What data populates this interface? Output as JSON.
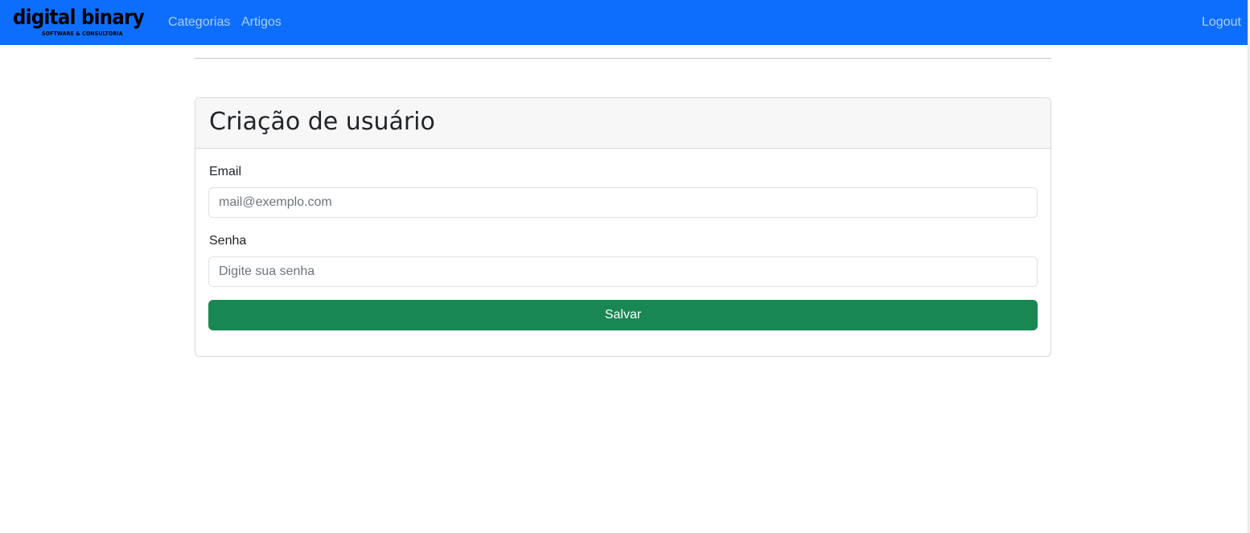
{
  "navbar": {
    "brand": {
      "name": "digital binary",
      "tagline": "SOFTWARE & CONSULTORIA"
    },
    "links": {
      "categorias": "Categorias",
      "artigos": "Artigos",
      "logout": "Logout"
    },
    "background_color": "#0d6efd"
  },
  "card": {
    "title": "Criação de usuário",
    "email": {
      "label": "Email",
      "value": "",
      "placeholder": "mail@exemplo.com"
    },
    "senha": {
      "label": "Senha",
      "value": "",
      "placeholder": "Digite sua senha"
    },
    "save_label": "Salvar",
    "save_color": "#198754"
  }
}
